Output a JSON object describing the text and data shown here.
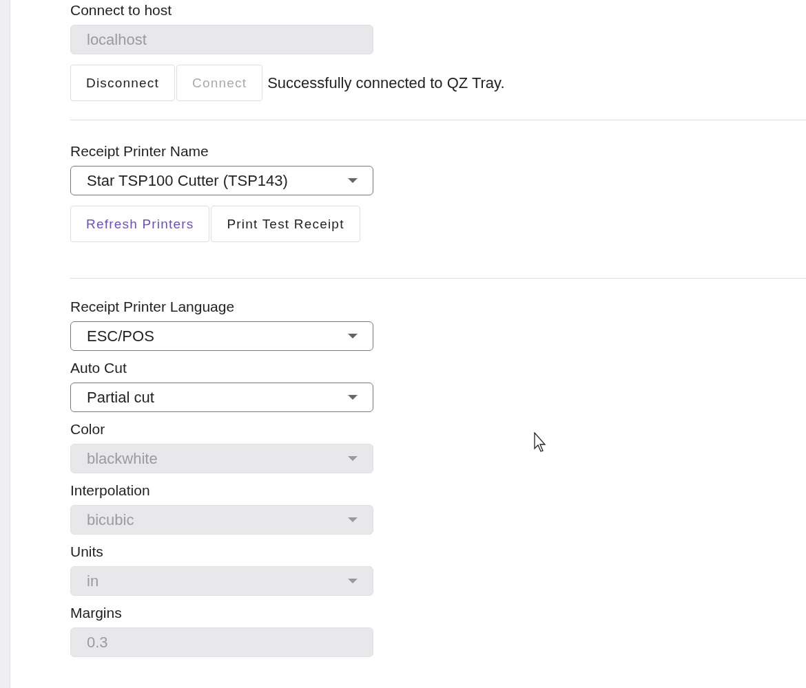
{
  "host": {
    "label": "Connect to host",
    "value": "localhost",
    "disabled": true
  },
  "connection_buttons": [
    {
      "label": "Disconnect",
      "disabled": false
    },
    {
      "label": "Connect",
      "disabled": true
    }
  ],
  "status_message": "Successfully connected to QZ Tray.",
  "printer": {
    "label": "Receipt Printer Name",
    "value": "Star TSP100 Cutter (TSP143)",
    "disabled": false
  },
  "printer_buttons": [
    {
      "label": "Refresh Printers",
      "kind": "accent"
    },
    {
      "label": "Print Test Receipt",
      "kind": "plain"
    }
  ],
  "settings": [
    {
      "label": "Receipt Printer Language",
      "value": "ESC/POS",
      "kind": "select",
      "disabled": false
    },
    {
      "label": "Auto Cut",
      "value": "Partial cut",
      "kind": "select",
      "disabled": false
    },
    {
      "label": "Color",
      "value": "blackwhite",
      "kind": "select",
      "disabled": true
    },
    {
      "label": "Interpolation",
      "value": "bicubic",
      "kind": "select",
      "disabled": true
    },
    {
      "label": "Units",
      "value": "in",
      "kind": "select",
      "disabled": true
    },
    {
      "label": "Margins",
      "value": "0.3",
      "kind": "text",
      "disabled": true
    }
  ]
}
